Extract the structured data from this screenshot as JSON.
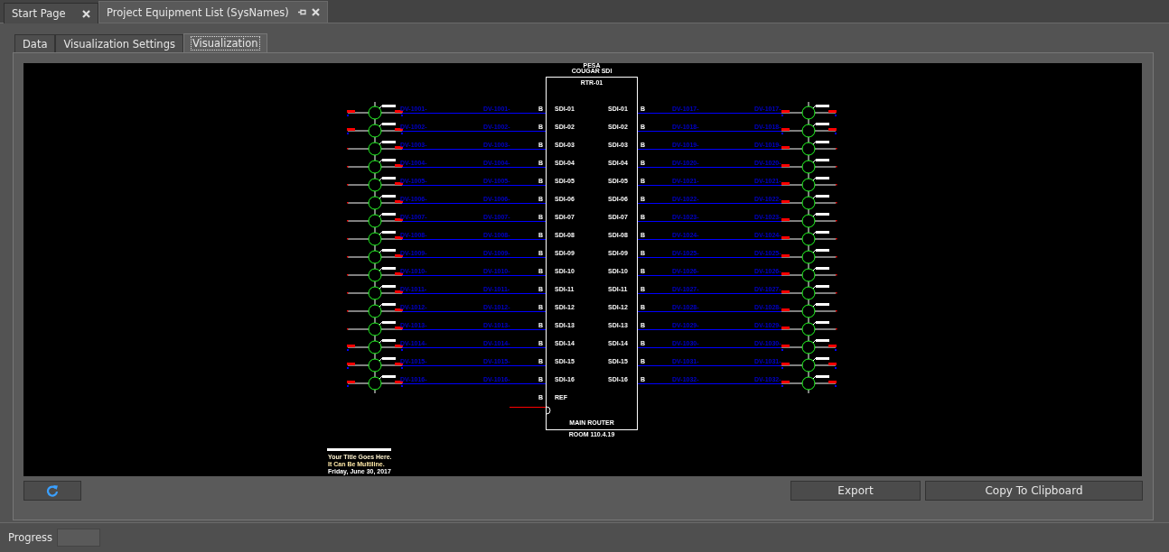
{
  "doc_tabs": [
    {
      "label": "Start Page",
      "selected": false,
      "closable": true,
      "pinnable": false
    },
    {
      "label": "Project Equipment List (SysNames)",
      "selected": true,
      "closable": true,
      "pinnable": true
    }
  ],
  "view_tabs": [
    {
      "label": "Data",
      "selected": false
    },
    {
      "label": "Visualization Settings",
      "selected": false
    },
    {
      "label": "Visualization",
      "selected": true
    }
  ],
  "diagram": {
    "maker": "PESA",
    "model": "COUGAR SDI",
    "device_id": "RTR-01",
    "room_label": "MAIN ROUTER",
    "room": "ROOM 110.4.19",
    "left_ports": [
      {
        "cable": "DV-1001-",
        "signal": "DV-1001-",
        "type": "B",
        "port": "SDI-01",
        "flagged": true
      },
      {
        "cable": "DV-1002-",
        "signal": "DV-1002-",
        "type": "B",
        "port": "SDI-02",
        "flagged": true
      },
      {
        "cable": "DV-1003-",
        "signal": "DV-1003-",
        "type": "B",
        "port": "SDI-03",
        "flagged": false
      },
      {
        "cable": "DV-1004-",
        "signal": "DV-1004-",
        "type": "B",
        "port": "SDI-04",
        "flagged": false
      },
      {
        "cable": "DV-1005-",
        "signal": "DV-1005-",
        "type": "B",
        "port": "SDI-05",
        "flagged": false
      },
      {
        "cable": "DV-1006-",
        "signal": "DV-1006-",
        "type": "B",
        "port": "SDI-06",
        "flagged": false
      },
      {
        "cable": "DV-1007-",
        "signal": "DV-1007-",
        "type": "B",
        "port": "SDI-07",
        "flagged": false
      },
      {
        "cable": "DV-1008-",
        "signal": "DV-1008-",
        "type": "B",
        "port": "SDI-08",
        "flagged": false
      },
      {
        "cable": "DV-1009-",
        "signal": "DV-1009-",
        "type": "B",
        "port": "SDI-09",
        "flagged": false
      },
      {
        "cable": "DV-1010-",
        "signal": "DV-1010-",
        "type": "B",
        "port": "SDI-10",
        "flagged": false
      },
      {
        "cable": "DV-1011-",
        "signal": "DV-1011-",
        "type": "B",
        "port": "SDI-11",
        "flagged": false
      },
      {
        "cable": "DV-1012-",
        "signal": "DV-1012-",
        "type": "B",
        "port": "SDI-12",
        "flagged": false
      },
      {
        "cable": "DV-1013-",
        "signal": "DV-1013-",
        "type": "B",
        "port": "SDI-13",
        "flagged": false
      },
      {
        "cable": "DV-1014-",
        "signal": "DV-1014-",
        "type": "B",
        "port": "SDI-14",
        "flagged": true
      },
      {
        "cable": "DV-1015-",
        "signal": "DV-1015-",
        "type": "B",
        "port": "SDI-15",
        "flagged": true
      },
      {
        "cable": "DV-1016-",
        "signal": "DV-1016-",
        "type": "B",
        "port": "SDI-16",
        "flagged": true
      }
    ],
    "ref_port": {
      "type": "B",
      "port": "REF"
    },
    "right_ports": [
      {
        "port": "SDI-01",
        "type": "B",
        "signal": "DV-1017-",
        "cable": "DV-1017-",
        "flagged": true
      },
      {
        "port": "SDI-02",
        "type": "B",
        "signal": "DV-1018-",
        "cable": "DV-1018-",
        "flagged": true
      },
      {
        "port": "SDI-03",
        "type": "B",
        "signal": "DV-1019-",
        "cable": "DV-1019-",
        "flagged": false
      },
      {
        "port": "SDI-04",
        "type": "B",
        "signal": "DV-1020-",
        "cable": "DV-1020-",
        "flagged": false
      },
      {
        "port": "SDI-05",
        "type": "B",
        "signal": "DV-1021-",
        "cable": "DV-1021-",
        "flagged": false
      },
      {
        "port": "SDI-06",
        "type": "B",
        "signal": "DV-1022-",
        "cable": "DV-1022-",
        "flagged": false
      },
      {
        "port": "SDI-07",
        "type": "B",
        "signal": "DV-1023-",
        "cable": "DV-1023-",
        "flagged": false
      },
      {
        "port": "SDI-08",
        "type": "B",
        "signal": "DV-1024-",
        "cable": "DV-1024-",
        "flagged": false
      },
      {
        "port": "SDI-09",
        "type": "B",
        "signal": "DV-1025-",
        "cable": "DV-1025-",
        "flagged": false
      },
      {
        "port": "SDI-10",
        "type": "B",
        "signal": "DV-1026-",
        "cable": "DV-1026-",
        "flagged": false
      },
      {
        "port": "SDI-11",
        "type": "B",
        "signal": "DV-1027-",
        "cable": "DV-1027-",
        "flagged": false
      },
      {
        "port": "SDI-12",
        "type": "B",
        "signal": "DV-1028-",
        "cable": "DV-1028-",
        "flagged": false
      },
      {
        "port": "SDI-13",
        "type": "B",
        "signal": "DV-1029-",
        "cable": "DV-1029-",
        "flagged": false
      },
      {
        "port": "SDI-14",
        "type": "B",
        "signal": "DV-1030-",
        "cable": "DV-1030-",
        "flagged": true
      },
      {
        "port": "SDI-15",
        "type": "B",
        "signal": "DV-1031-",
        "cable": "DV-1031-",
        "flagged": true
      },
      {
        "port": "SDI-16",
        "type": "B",
        "signal": "DV-1032-",
        "cable": "DV-1032-",
        "flagged": true
      }
    ],
    "title_block": [
      "Your Title Goes Here.",
      "It Can Be Multiline.",
      "Friday, June 30, 2017"
    ]
  },
  "buttons": [
    {
      "kind": "refresh"
    },
    {
      "kind": "text",
      "label": "Export"
    },
    {
      "kind": "text",
      "label": "Copy To Clipboard"
    }
  ],
  "status_bar": {
    "label": "Progress",
    "level": 0
  }
}
